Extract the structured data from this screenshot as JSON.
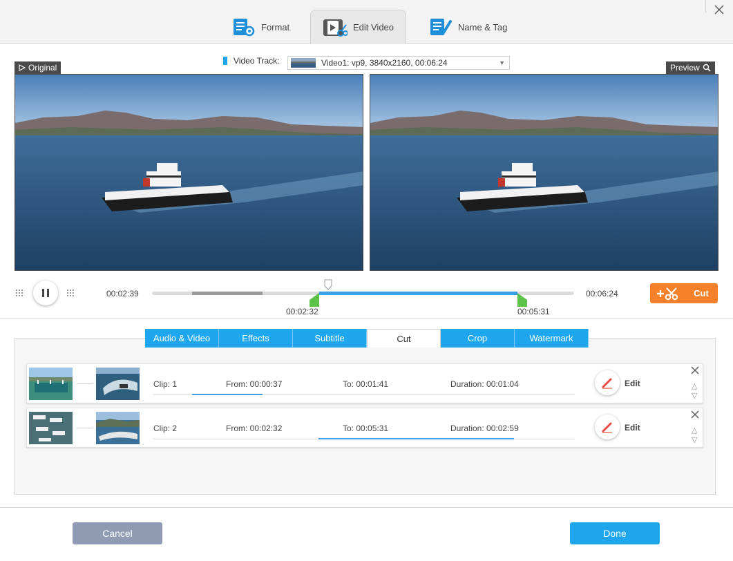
{
  "tabs": [
    {
      "label": "Format",
      "icon": "format-settings-icon"
    },
    {
      "label": "Edit Video",
      "icon": "edit-video-icon"
    },
    {
      "label": "Name & Tag",
      "icon": "name-tag-icon"
    }
  ],
  "track": {
    "label": "Video Track:",
    "value": "Video1: vp9, 3840x2160, 00:06:24"
  },
  "panes": {
    "original_label": "Original",
    "preview_label": "Preview"
  },
  "playback": {
    "current_time": "00:02:39",
    "total_time": "00:06:24",
    "start_marker": "00:02:32",
    "end_marker": "00:05:31",
    "cut_label": "Cut"
  },
  "edit_tabs": [
    {
      "label": "Audio & Video"
    },
    {
      "label": "Effects"
    },
    {
      "label": "Subtitle"
    },
    {
      "label": "Cut"
    },
    {
      "label": "Crop"
    },
    {
      "label": "Watermark"
    }
  ],
  "clips": [
    {
      "clip": "Clip: 1",
      "from": "From:  00:00:37",
      "to": "To:  00:01:41",
      "duration": "Duration: 00:01:04",
      "edit": "Edit"
    },
    {
      "clip": "Clip: 2",
      "from": "From:  00:02:32",
      "to": "To:  00:05:31",
      "duration": "Duration: 00:02:59",
      "edit": "Edit"
    }
  ],
  "buttons": {
    "cancel": "Cancel",
    "done": "Done"
  },
  "colors": {
    "accent": "#1ea7ee",
    "cut": "#f7812b",
    "cancel": "#8f9bb3",
    "marker": "#5cc24a"
  }
}
